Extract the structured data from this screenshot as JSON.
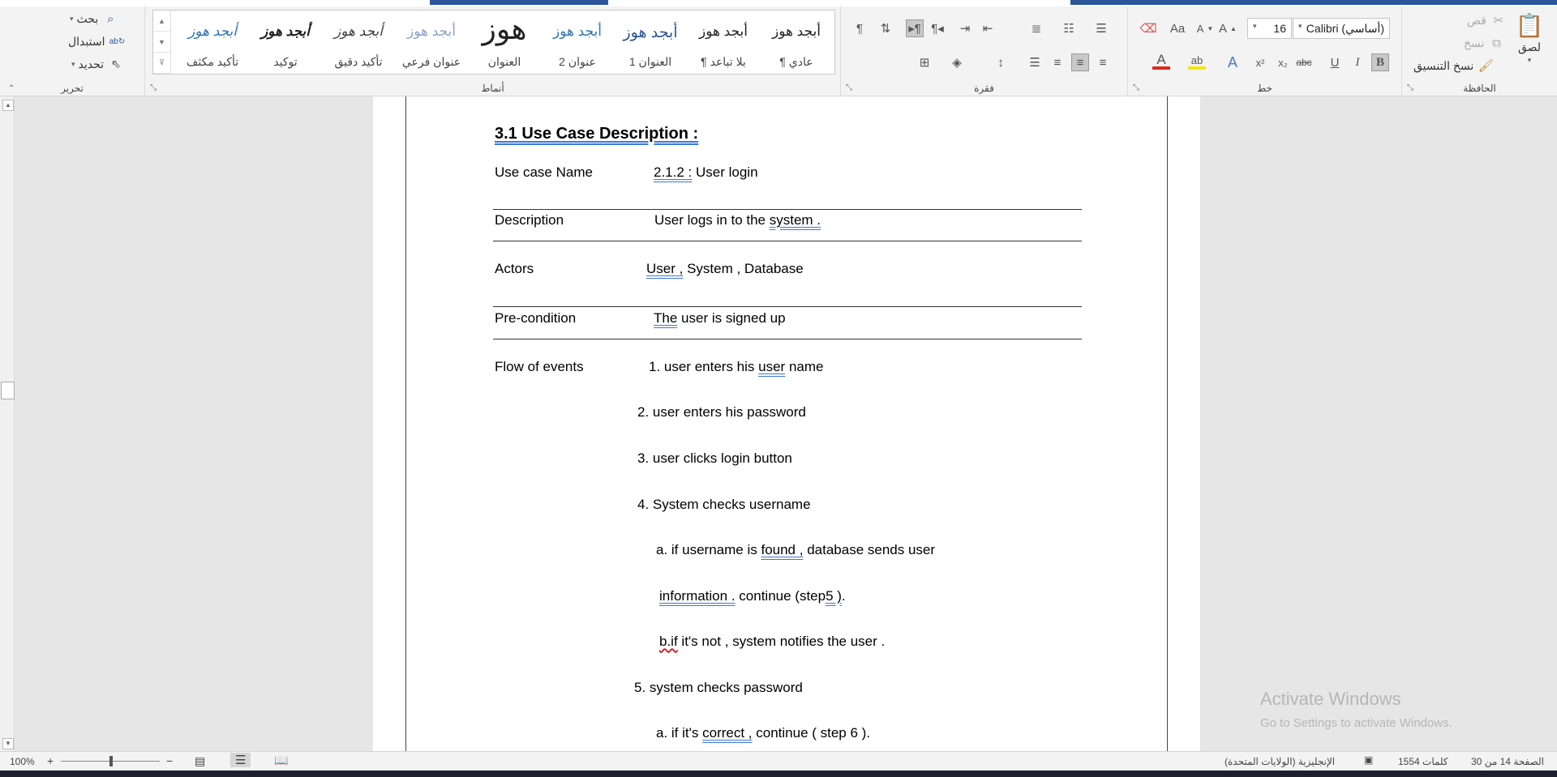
{
  "ribbon": {
    "clipboard": {
      "group_label": "الحافظة",
      "paste": "لصق",
      "cut": "قص",
      "copy": "نسخ",
      "format_painter": "نسخ التنسيق"
    },
    "font": {
      "group_label": "خط",
      "font_name": "Calibri (أساسي)",
      "font_size": "16",
      "bold": "B",
      "italic": "I",
      "underline": "U",
      "strike": "abc",
      "subscript": "x₂",
      "superscript": "x²",
      "grow": "A",
      "shrink": "A",
      "change_case": "Aa",
      "font_color": "A",
      "highlight": "ab"
    },
    "paragraph": {
      "group_label": "فقرة",
      "show_marks": "¶"
    },
    "styles": {
      "group_label": "أنماط",
      "items": [
        {
          "sample": "أبجد هوز",
          "name": "¶ عادي"
        },
        {
          "sample": "أبجد هوز",
          "name": "¶ بلا تباعد"
        },
        {
          "sample": "أبجد هوز",
          "name": "العنوان 1"
        },
        {
          "sample": "أبجد هوز",
          "name": "عنوان 2"
        },
        {
          "sample": "هوز",
          "name": "العنوان"
        },
        {
          "sample": "أبجد هوز",
          "name": "عنوان فرعي"
        },
        {
          "sample": "أبجد هوز",
          "name": "تأكيد دقيق"
        },
        {
          "sample": "أبجد هوز",
          "name": "توكيد"
        },
        {
          "sample": "أبجد هوز",
          "name": "تأكيد مكثف"
        }
      ]
    },
    "editing": {
      "group_label": "تحرير",
      "find": "بحث",
      "replace": "استبدال",
      "select": "تحديد"
    }
  },
  "document": {
    "heading": "3.1 Use Case Description :",
    "rows": {
      "name_label": "Use case Name",
      "name_value_num": "2.1.2 :",
      "name_value_text": "User login",
      "desc_label": "Description",
      "desc_value": "User logs in to the",
      "desc_value_tail": "system .",
      "actors_label": "Actors",
      "actors_user": "User ,",
      "actors_rest": "System , Database",
      "pre_label": "Pre-condition",
      "pre_the": "The",
      "pre_rest": "user is signed up",
      "flow_label": "Flow of events"
    },
    "flow": {
      "s1_a": "1. user enters his",
      "s1_b": "user",
      "s1_c": "name",
      "s2": "2. user enters his password",
      "s3": "3. user clicks login button",
      "s4": "4. System checks username",
      "s4a_a": "a. if username is",
      "s4a_b": "found ,",
      "s4a_c": "database sends user",
      "s4a2_a": "information .",
      "s4a2_b": "continue (step",
      "s4a2_c": "5 )",
      "s4a2_d": ".",
      "s4b_a": "b.if",
      "s4b_b": "it's not , system notifies the user .",
      "s5": "5. system checks password",
      "s5a_a": "a. if it's",
      "s5a_b": "correct ,",
      "s5a_c": "continue ( step 6 )."
    }
  },
  "watermark": {
    "line1": "Activate Windows",
    "line2": "Go to Settings to activate Windows."
  },
  "statusbar": {
    "page": "الصفحة 14 من 30",
    "words": "1554 كلمات",
    "language": "الإنجليزية (الولايات المتحدة)",
    "zoom": "100%",
    "zoom_minus": "−",
    "zoom_plus": "+"
  }
}
